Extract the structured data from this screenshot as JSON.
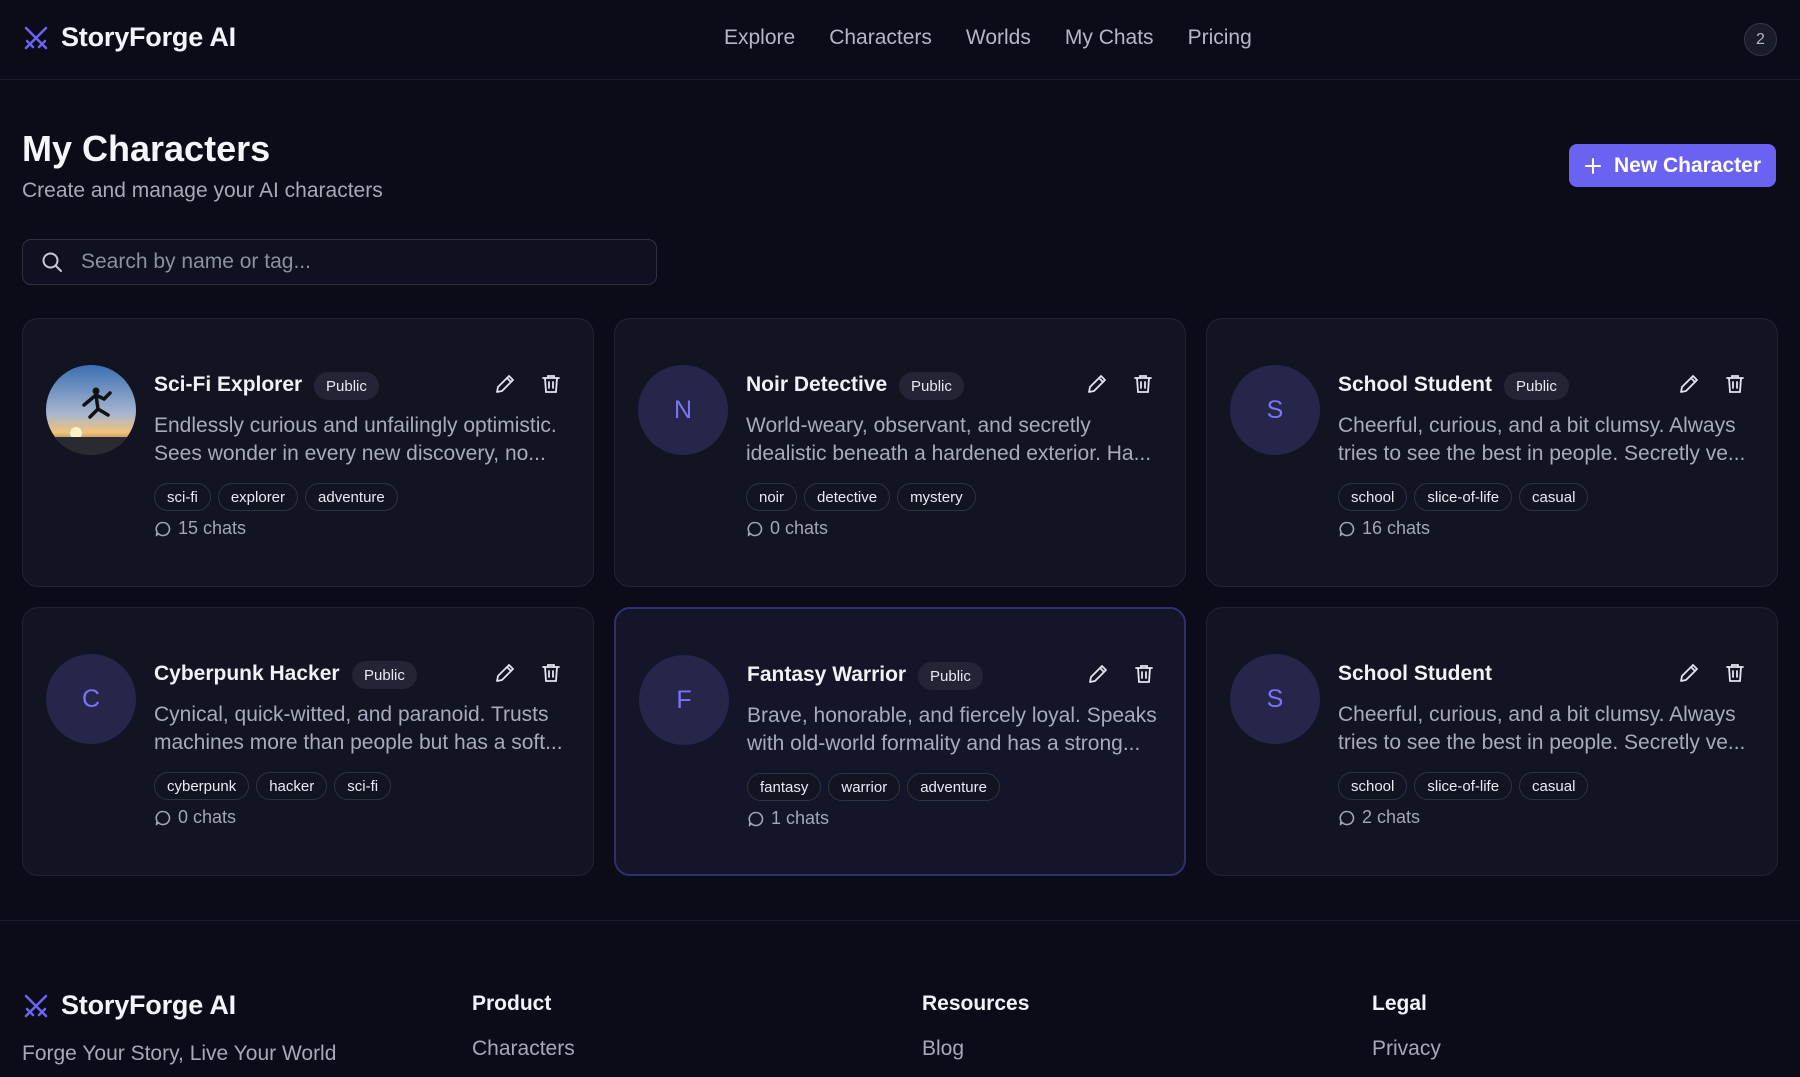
{
  "app": {
    "name": "StoryForge AI",
    "accent": "#6a63f2"
  },
  "nav": {
    "items": [
      {
        "label": "Explore"
      },
      {
        "label": "Characters"
      },
      {
        "label": "Worlds"
      },
      {
        "label": "My Chats"
      },
      {
        "label": "Pricing"
      }
    ],
    "avatar_badge": "2"
  },
  "page": {
    "title": "My Characters",
    "subtitle": "Create and manage your AI characters",
    "new_button_label": "New Character"
  },
  "search": {
    "placeholder": "Search by name or tag...",
    "value": ""
  },
  "cards": [
    {
      "name": "Sci-Fi Explorer",
      "visibility": "Public",
      "avatar": "image",
      "desc_line1": "Endlessly curious and unfailingly optimistic.",
      "desc_line2": "Sees wonder in every new discovery, no...",
      "tags": [
        "sci-fi",
        "explorer",
        "adventure"
      ],
      "chats": "15 chats"
    },
    {
      "name": "Noir Detective",
      "visibility": "Public",
      "avatar": "N",
      "desc_line1": "World-weary, observant, and secretly",
      "desc_line2": "idealistic beneath a hardened exterior. Ha...",
      "tags": [
        "noir",
        "detective",
        "mystery"
      ],
      "chats": "0 chats"
    },
    {
      "name": "School Student",
      "visibility": "Public",
      "avatar": "S",
      "desc_line1": "Cheerful, curious, and a bit clumsy. Always",
      "desc_line2": "tries to see the best in people. Secretly ve...",
      "tags": [
        "school",
        "slice-of-life",
        "casual"
      ],
      "chats": "16 chats"
    },
    {
      "name": "Cyberpunk Hacker",
      "visibility": "Public",
      "avatar": "C",
      "desc_line1": "Cynical, quick-witted, and paranoid. Trusts",
      "desc_line2": "machines more than people but has a soft...",
      "tags": [
        "cyberpunk",
        "hacker",
        "sci-fi"
      ],
      "chats": "0 chats"
    },
    {
      "name": "Fantasy Warrior",
      "visibility": "Public",
      "avatar": "F",
      "desc_line1": "Brave, honorable, and fiercely loyal. Speaks",
      "desc_line2": "with old-world formality and has a strong...",
      "tags": [
        "fantasy",
        "warrior",
        "adventure"
      ],
      "chats": "1 chats"
    },
    {
      "name": "School Student",
      "avatar": "S",
      "desc_line1": "Cheerful, curious, and a bit clumsy. Always",
      "desc_line2": "tries to see the best in people. Secretly ve...",
      "tags": [
        "school",
        "slice-of-life",
        "casual"
      ],
      "chats": "2 chats"
    }
  ],
  "footer": {
    "brand": "StoryForge AI",
    "tagline": "Forge Your Story, Live Your World",
    "columns": [
      {
        "title": "Product",
        "link": "Characters"
      },
      {
        "title": "Resources",
        "link": "Blog"
      },
      {
        "title": "Legal",
        "link": "Privacy"
      }
    ]
  }
}
